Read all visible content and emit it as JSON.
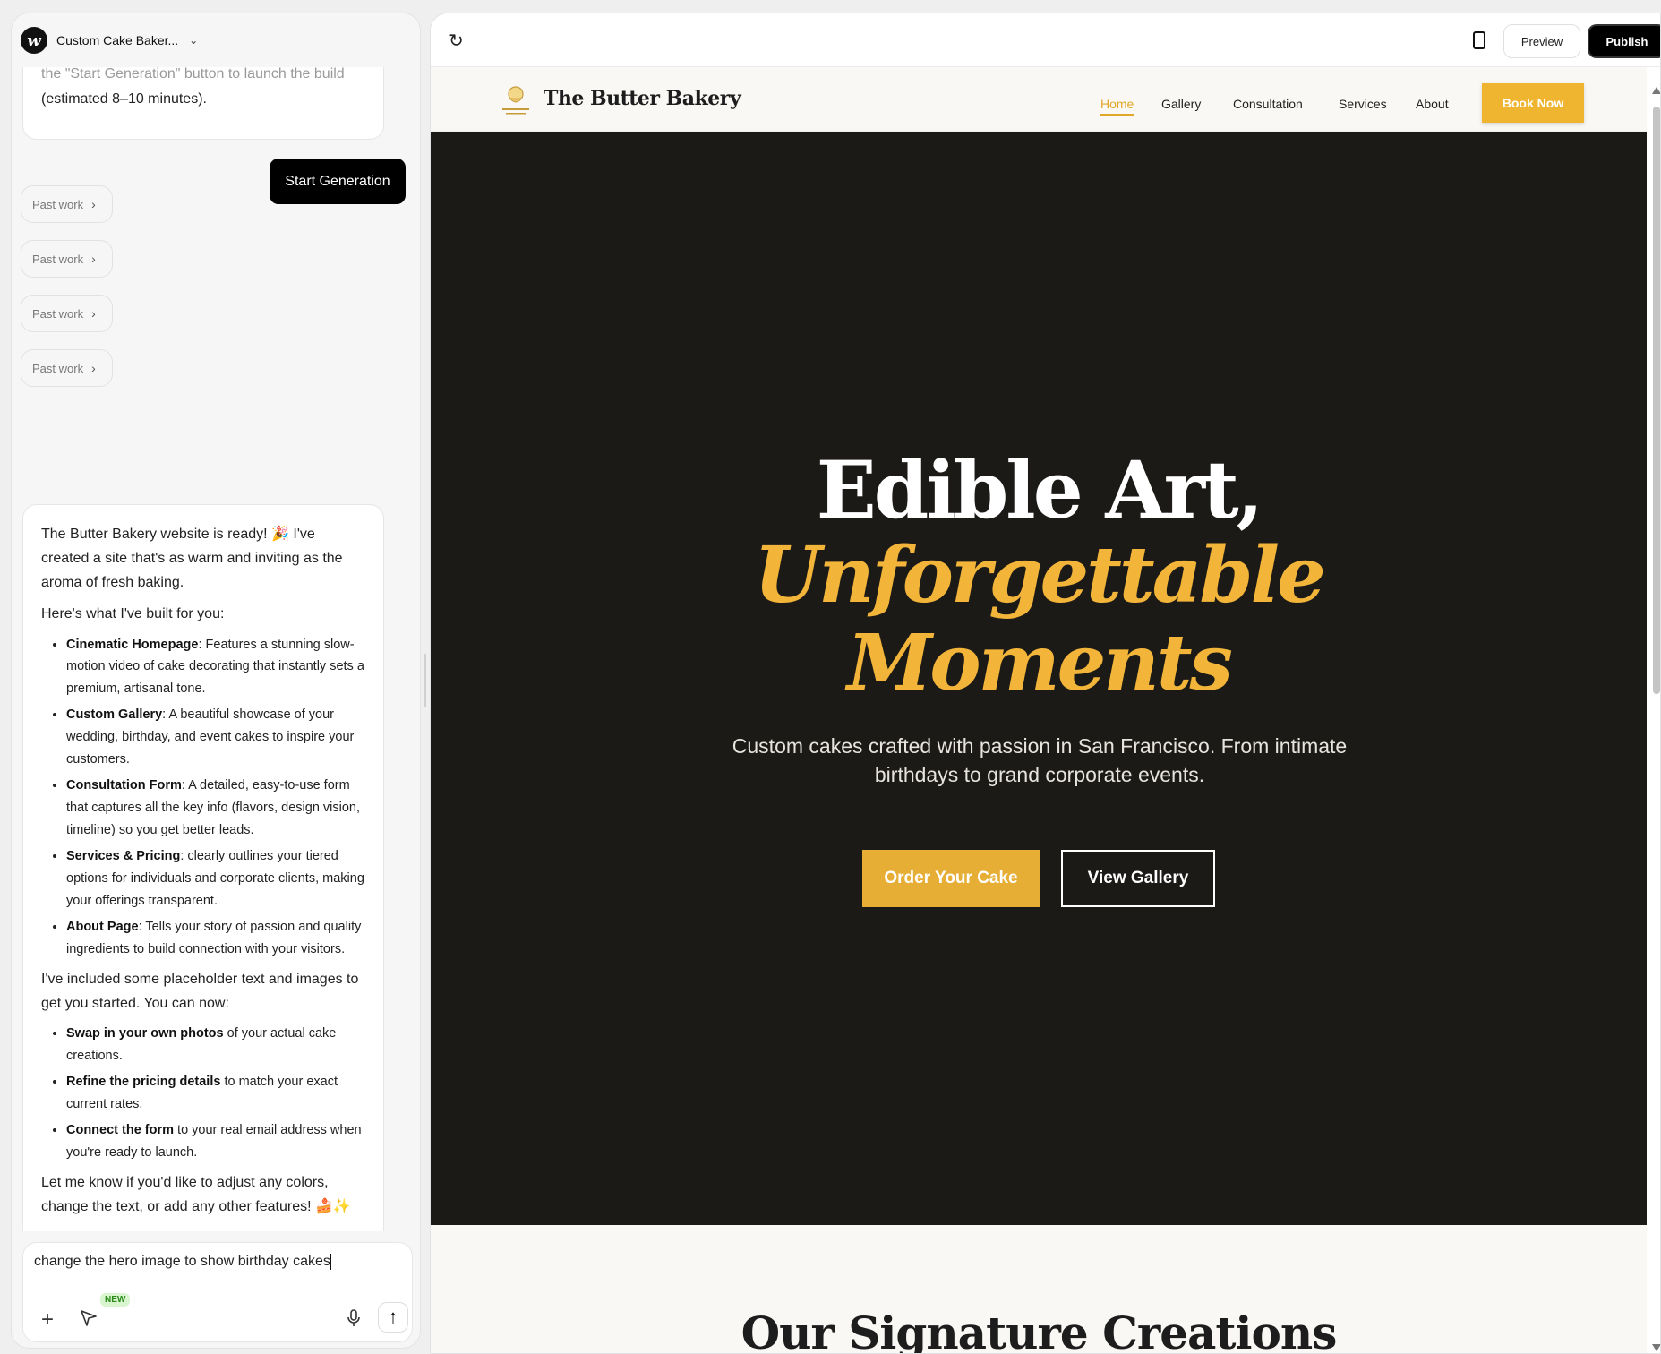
{
  "app": {
    "project_name": "Custom Cake Baker...",
    "logo_glyph": "w"
  },
  "chat": {
    "prev_message_faded": "the \"Start Generation\" button to launch the build",
    "prev_message_tail": "(estimated 8–10 minutes).",
    "start_button": "Start Generation",
    "past_work": [
      "Past work",
      "Past work",
      "Past work",
      "Past work"
    ],
    "reply": {
      "intro": "The Butter Bakery website is ready! 🎉 I've created a site that's as warm and inviting as the aroma of fresh baking.",
      "built_heading": "Here's what I've built for you:",
      "built_items": [
        {
          "bold": "Cinematic Homepage",
          "text": ": Features a stunning slow-motion video of cake decorating that instantly sets a premium, artisanal tone."
        },
        {
          "bold": "Custom Gallery",
          "text": ": A beautiful showcase of your wedding, birthday, and event cakes to inspire your customers."
        },
        {
          "bold": "Consultation Form",
          "text": ": A detailed, easy-to-use form that captures all the key info (flavors, design vision, timeline) so you get better leads."
        },
        {
          "bold": "Services & Pricing",
          "text": ": clearly outlines your tiered options for individuals and corporate clients, making your offerings transparent."
        },
        {
          "bold": "About Page",
          "text": ": Tells your story of passion and quality ingredients to build connection with your visitors."
        }
      ],
      "next_heading": "I've included some placeholder text and images to get you started. You can now:",
      "next_items": [
        {
          "bold": "Swap in your own photos",
          "text": " of your actual cake creations."
        },
        {
          "bold": "Refine the pricing details",
          "text": " to match your exact current rates."
        },
        {
          "bold": "Connect the form",
          "text": " to your real email address when you're ready to launch."
        }
      ],
      "closing": "Let me know if you'd like to adjust any colors, change the text, or add any other features! 🍰✨"
    },
    "composer": {
      "value": "change the hero image to show birthday cakes",
      "new_badge": "NEW"
    }
  },
  "preview": {
    "preview_button": "Preview",
    "publish_button": "Publish",
    "site": {
      "brand": "The Butter Bakery",
      "nav": [
        "Home",
        "Gallery",
        "Consultation",
        "Services",
        "About"
      ],
      "active_nav": "Home",
      "book_button": "Book Now",
      "hero": {
        "line1": "Edible Art,",
        "line2": "Unforgettable",
        "line3": "Moments",
        "subtitle": "Custom cakes crafted with passion in San Francisco. From intimate birthdays to grand corporate events.",
        "primary_cta": "Order Your Cake",
        "secondary_cta": "View Gallery"
      },
      "section_title": "Our Signature Creations"
    },
    "colors": {
      "accent_gold": "#f0b530",
      "hero_bg": "#1c1a17",
      "publish_bg": "#000000"
    }
  }
}
